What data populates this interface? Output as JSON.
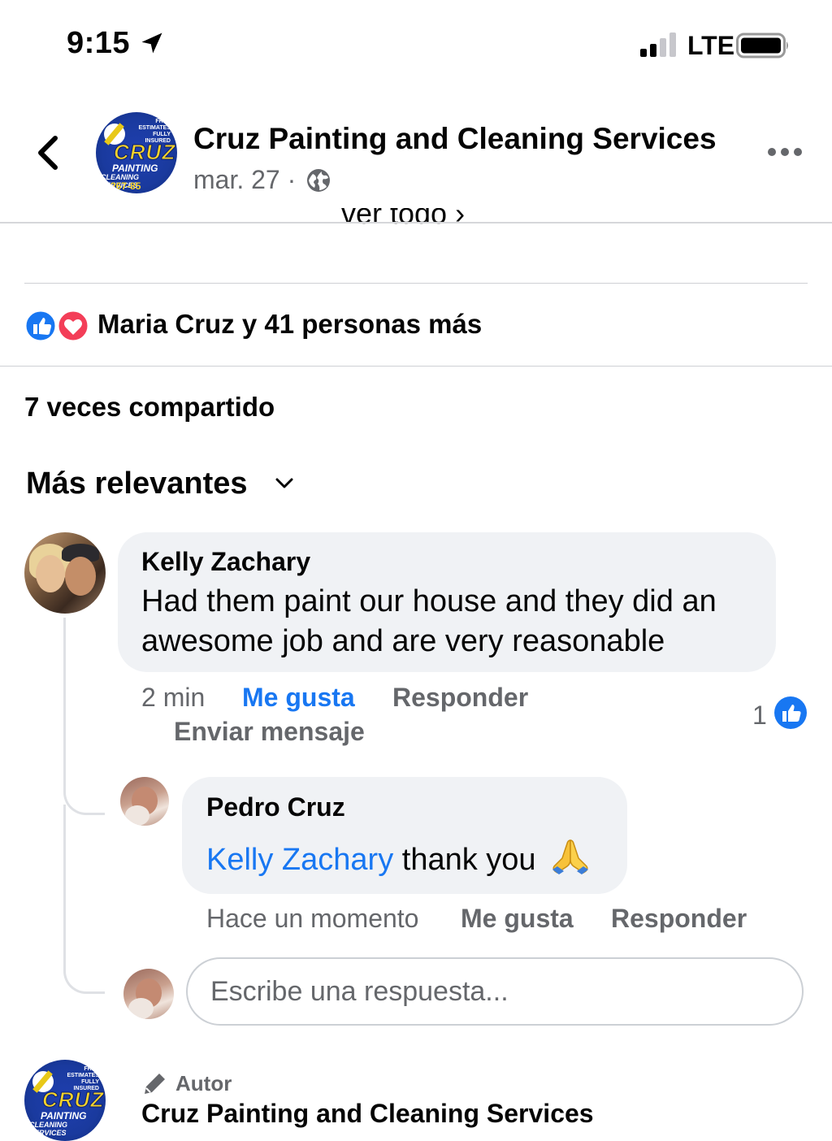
{
  "status_bar": {
    "time": "9:15",
    "network": "LTE"
  },
  "header": {
    "page_name": "Cruz Painting and Cleaning Services",
    "date": "mar. 27 ·",
    "logo": {
      "top_text": "FREE ESTIMATES FULLY INSURED",
      "brand": "CRUZ",
      "line1": "PAINTING",
      "line2": "CLEANING SERVICES",
      "phone": "267-85"
    }
  },
  "cutoff_link": "ver todo  ›",
  "reactions": {
    "summary": "Maria Cruz y 41 personas más"
  },
  "shares": "7 veces compartido",
  "sort": {
    "label": "Más relevantes"
  },
  "comments": [
    {
      "author": "Kelly Zachary",
      "text": "Had them paint our house and they did an awesome job and are very reasonable",
      "time": "2 min",
      "like_label": "Me gusta",
      "reply_label": "Responder",
      "message_label": "Enviar mensaje",
      "like_count": "1",
      "replies": [
        {
          "author": "Pedro Cruz",
          "mention": "Kelly Zachary",
          "text": " thank you",
          "time": "Hace un momento",
          "like_label": "Me gusta",
          "reply_label": "Responder"
        }
      ]
    }
  ],
  "reply_box": {
    "placeholder": "Escribe una respuesta..."
  },
  "next_comment": {
    "badge": "Autor",
    "author": "Cruz Painting and Cleaning Services"
  },
  "colors": {
    "link": "#1877f2",
    "secondary_text": "#65676b",
    "bubble": "#f0f2f5",
    "love": "#f33e58"
  }
}
